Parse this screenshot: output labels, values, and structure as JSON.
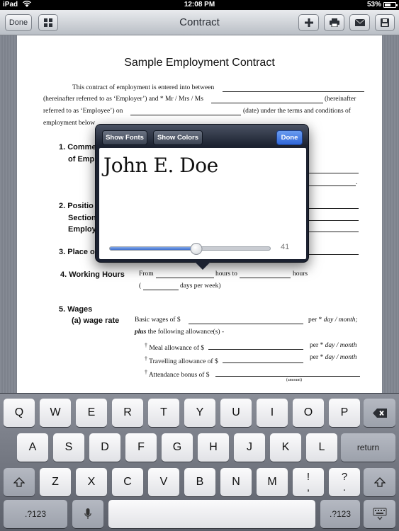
{
  "status_bar": {
    "device": "iPad",
    "time": "12:08 PM",
    "battery": "53%",
    "battery_level": 0.53
  },
  "toolbar": {
    "done_label": "Done",
    "title": "Contract"
  },
  "document": {
    "title": "Sample Employment Contract",
    "intro_line1": "This contract of employment is entered into between",
    "intro_line2a": "(hereinafter referred to as ‘Employer’) and * Mr / Mrs / Ms",
    "intro_line2b": "(hereinafter",
    "intro_line3a": "referred to as ‘Employee’) on",
    "intro_line3b": "(date) under the terms and conditions of",
    "intro_line4": "employment below",
    "s1_a": "1. Comme",
    "s1_b": "of Emp",
    "s2_a": "2. Positio",
    "s2_b": "Section",
    "s2_c": "Employ",
    "s3": "3. Place o",
    "s4": "4. Working Hours",
    "from": "From",
    "hours_to": "hours to",
    "hours": "hours",
    "open_paren": "(",
    "days_per_week": "days per week)",
    "s5": "5. Wages",
    "s5a": "(a) wage rate",
    "basic_wages": "Basic wages of $",
    "per": "per *",
    "day_month": "day / month;",
    "plus": "plus",
    "allowances": "the following allowance(s) -",
    "dagger": "†",
    "meal": "Meal allowance of $",
    "travel": "Travelling allowance of $",
    "attendance": "Attendance bonus of $",
    "day_month2": "day / month",
    "amount": "(amount)",
    "period": "."
  },
  "popover": {
    "show_fonts": "Show Fonts",
    "show_colors": "Show Colors",
    "done": "Done",
    "signature_text": "John E. Doe",
    "size_value": "41",
    "slider_fraction": 0.54
  },
  "keyboard": {
    "row1": [
      "Q",
      "W",
      "E",
      "R",
      "T",
      "Y",
      "U",
      "I",
      "O",
      "P"
    ],
    "row2": [
      "A",
      "S",
      "D",
      "F",
      "G",
      "H",
      "J",
      "K",
      "L"
    ],
    "row3": [
      "Z",
      "X",
      "C",
      "V",
      "B",
      "N",
      "M"
    ],
    "return": "return",
    "numbers": ".?123",
    "excl_top": "!",
    "excl_bottom": ",",
    "q_top": "?",
    "q_bottom": "."
  }
}
